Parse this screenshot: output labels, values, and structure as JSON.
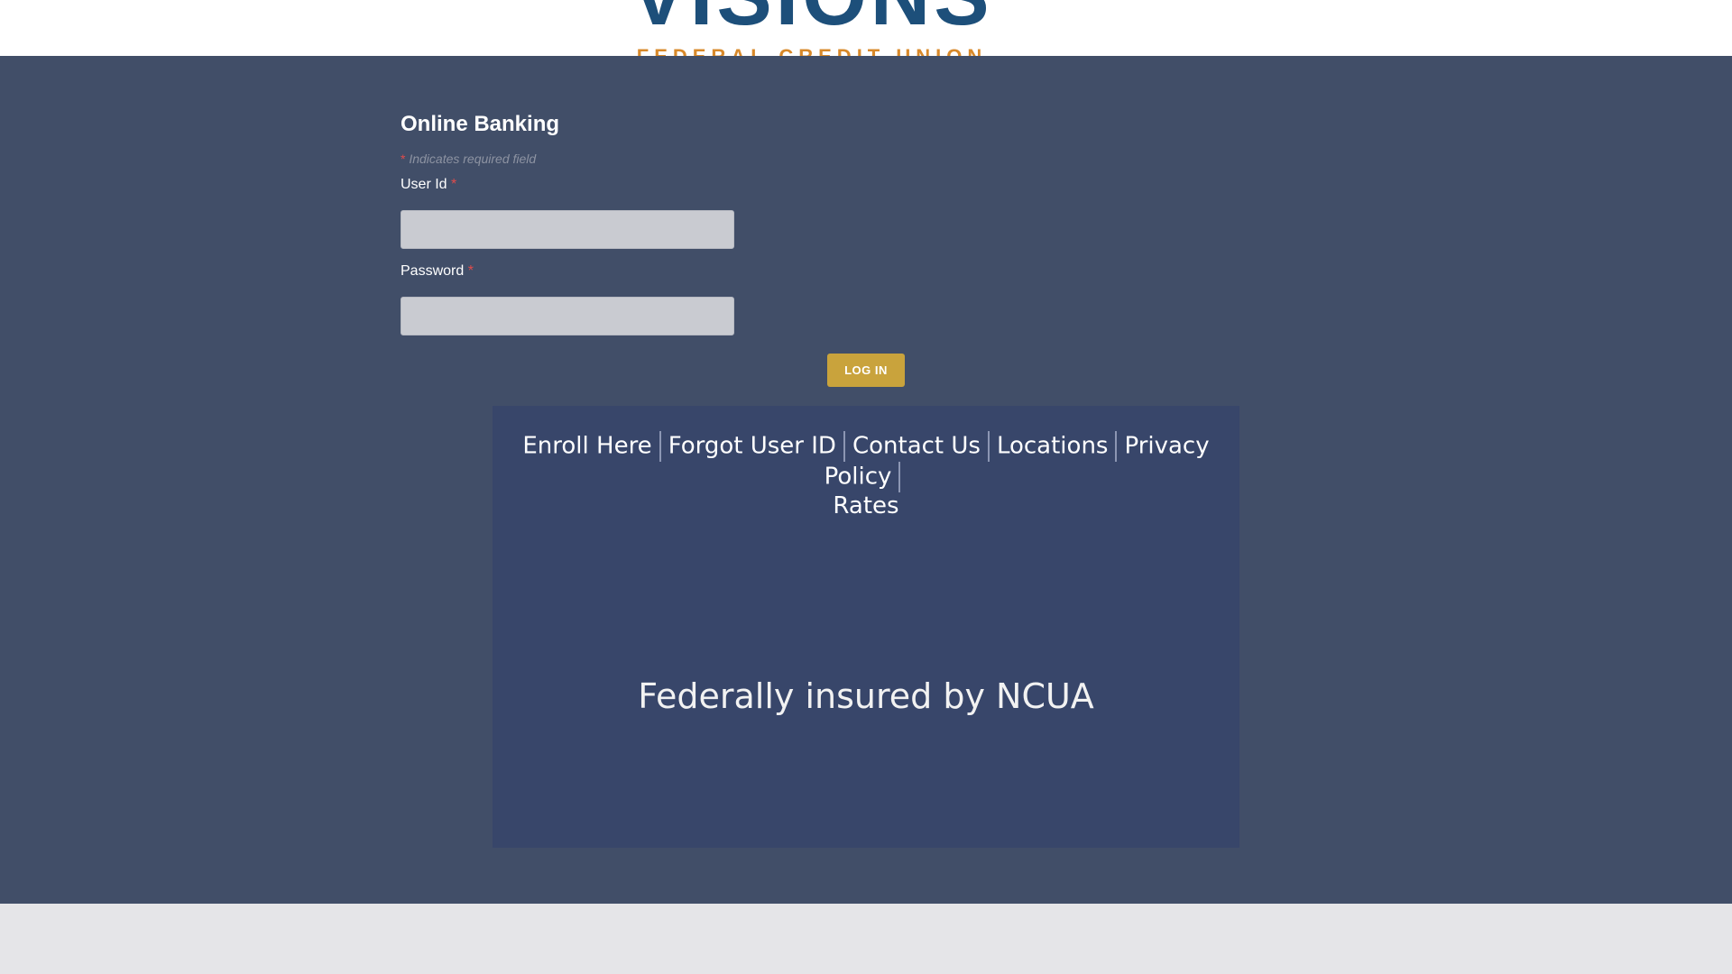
{
  "header": {
    "logo_word": "VISIONS",
    "logo_subtitle": "FEDERAL CREDIT UNION"
  },
  "form": {
    "title": "Online Banking",
    "required_star": "*",
    "required_note": "Indicates required field",
    "user_id_label": "User Id",
    "password_label": "Password",
    "user_id_value": "",
    "password_value": "",
    "login_button": "LOG IN"
  },
  "links": {
    "items": [
      {
        "label": "Enroll Here"
      },
      {
        "label": "Forgot User ID"
      },
      {
        "label": "Contact Us"
      },
      {
        "label": "Locations"
      },
      {
        "label": "Privacy Policy"
      }
    ],
    "rates": "Rates"
  },
  "insured_text": "Federally insured by NCUA",
  "colors": {
    "main_bg": "#414e68",
    "panel_bg": "#38466a",
    "button": "#c9a33c",
    "required": "#e04b4b"
  }
}
